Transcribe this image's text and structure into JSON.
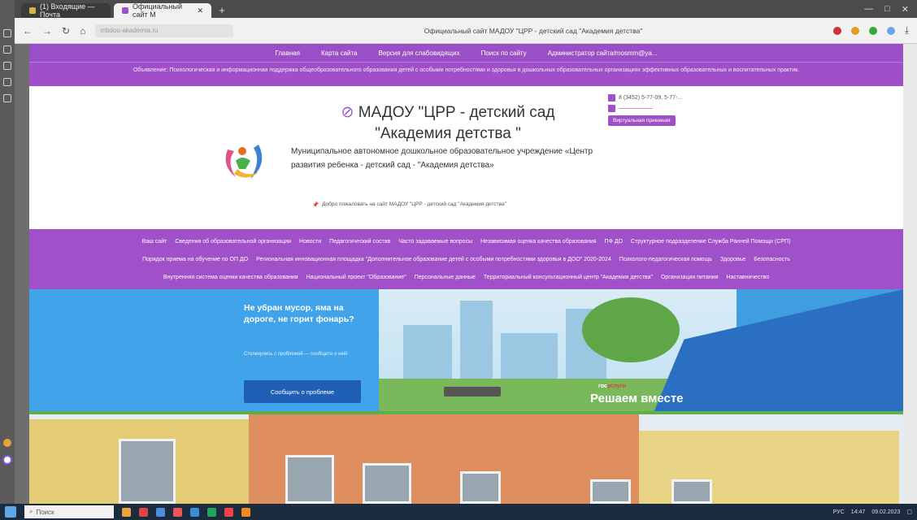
{
  "browser": {
    "tabs": [
      {
        "label": "(1) Входящие — Почта",
        "active": false
      },
      {
        "label": "Официальный сайт М",
        "active": true
      }
    ],
    "new_tab": "+",
    "address": "mbdou-akademia.ru",
    "page_title": "Официальный сайт МАДОУ \"ЦРР - детский сад \"Академия детства\"",
    "window_controls": [
      "—",
      "□",
      "✕"
    ]
  },
  "topnav": {
    "items": [
      "Главная",
      "Карта сайта",
      "Версия для слабовидящих",
      "Поиск по сайту",
      "Администратор сайта/mosmm@ya..."
    ]
  },
  "announce": {
    "text": "Объявление: Психологическая и информационная поддержка общеобразовательного образования детей с особыми потребностями и здоровья в дошкольных образовательных организациях эффективных образовательных и воспитательных практик."
  },
  "header": {
    "title": "МАДОУ \"ЦРР - детский сад \"Академия детства \"",
    "subtitle": "Муниципальное автономное дошкольное образовательное учреждение «Центр развития ребенка - детский сад - \"Академия детства»",
    "welcome": "Добро пожаловать на сайт МАДОУ \"ЦРР - детский сад \"Академия детства\"",
    "contact_phone": "8 (3452) 5-77-09, 5-77-...",
    "contact_email": "——————",
    "virtual_button": "Виртуальная приемная"
  },
  "mainmenu": {
    "rows": [
      [
        "Ваш сайт",
        "Сведения об образовательной организации",
        "Новости",
        "Педагогический состав",
        "Часто задаваемые вопросы",
        "Независимая оценка качества образования",
        "ПФ ДО",
        "Структурное подразделение Служба Ранней Помощи (СРП)"
      ],
      [
        "Порядок приема на обучение по ОП ДО",
        "Региональная инновационная площадка \"Дополнительное образование детей с особыми потребностями здоровья в ДОО\" 2020-2024",
        "Психолого-педагогическая помощь",
        "Здоровье",
        "Безопасность"
      ],
      [
        "Внутренняя система оценки качества образования",
        "Национальный проект \"Образование\"",
        "Персональные данные",
        "Территориальный консультационный центр \"Академия детства\"",
        "Организация питания",
        "Наставничество"
      ]
    ]
  },
  "banner": {
    "headline": "Не убран мусор, яма на дороге, не горит фонарь?",
    "small": "Столкнулись с проблемой — сообщите о ней!",
    "button": "Сообщить о проблеме",
    "logo_gos": "гос",
    "logo_uslugi": "услуги",
    "slogan": "Решаем вместе"
  },
  "taskbar": {
    "search": "Поиск",
    "tray_lang": "РУС",
    "time": "14:47",
    "date": "09.02.2023"
  },
  "colors": {
    "purple": "#a050c8",
    "banner_blue": "#41a3ea",
    "button_blue": "#1f5fb6"
  }
}
